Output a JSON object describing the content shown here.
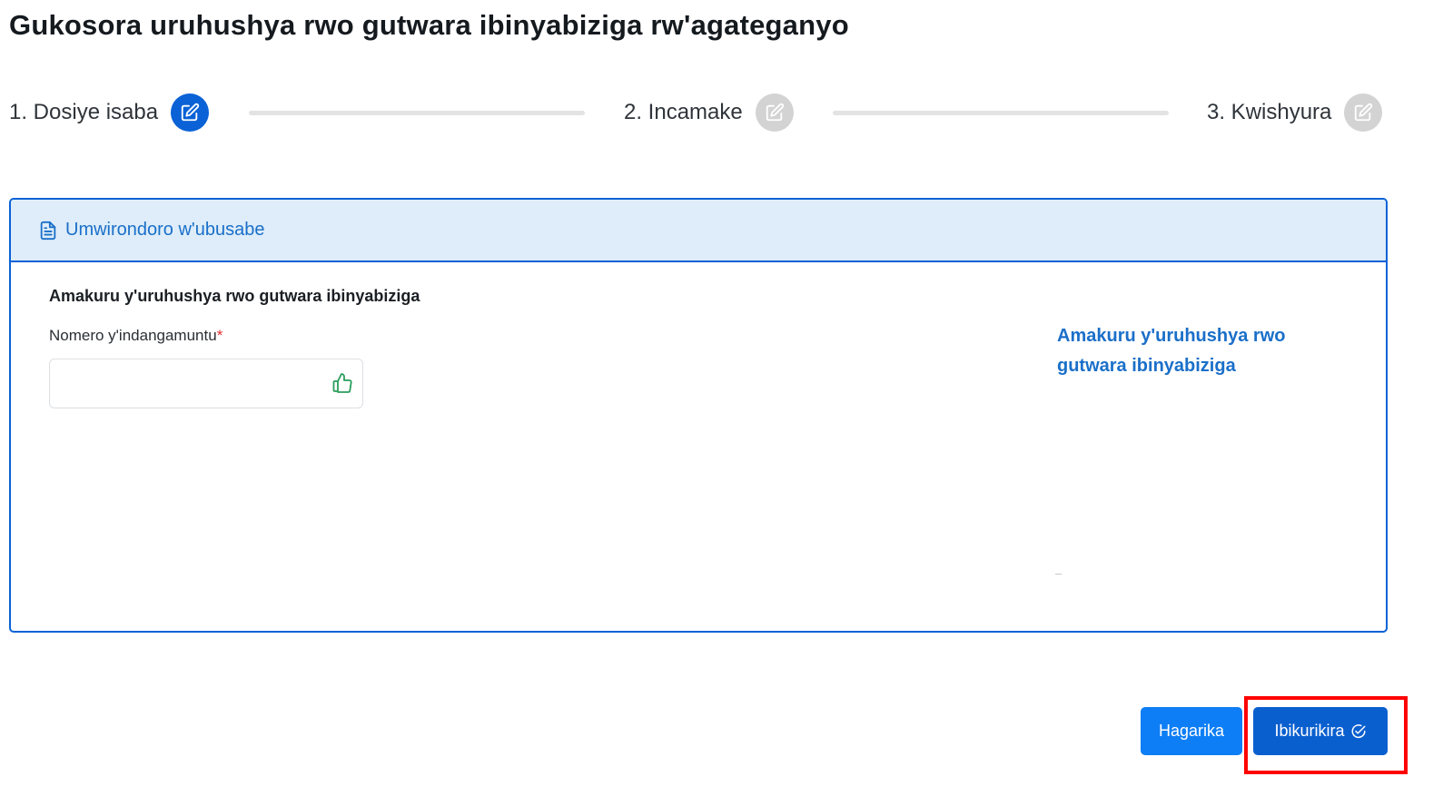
{
  "page": {
    "title": "Gukosora uruhushya rwo gutwara ibinyabiziga rw'agateganyo"
  },
  "stepper": {
    "steps": [
      {
        "label": "1. Dosiye isaba",
        "state": "active",
        "icon": "edit-icon"
      },
      {
        "label": "2. Incamake",
        "state": "inactive",
        "icon": "edit-icon"
      },
      {
        "label": "3. Kwishyura",
        "state": "inactive",
        "icon": "edit-icon"
      }
    ]
  },
  "panel": {
    "header_icon": "document-icon",
    "header_title": "Umwirondoro w'ubusabe",
    "section_title": "Amakuru y'uruhushya rwo gutwara ibinyabiziga",
    "id_field": {
      "label": "Nomero y'indangamuntu",
      "required_mark": "*",
      "value": "",
      "icon": "thumbs-up-icon"
    },
    "side_link": "Amakuru y'uruhushya rwo gutwara ibinyabiziga"
  },
  "actions": {
    "cancel_label": "Hagarika",
    "next_label": "Ibikurikira",
    "next_icon": "check-circle-icon"
  },
  "colors": {
    "primary": "#0a62d6",
    "header_bg": "#deedf9",
    "link": "#1a6fc9",
    "success_icon": "#2a9d5c",
    "highlight": "#ff0000"
  }
}
